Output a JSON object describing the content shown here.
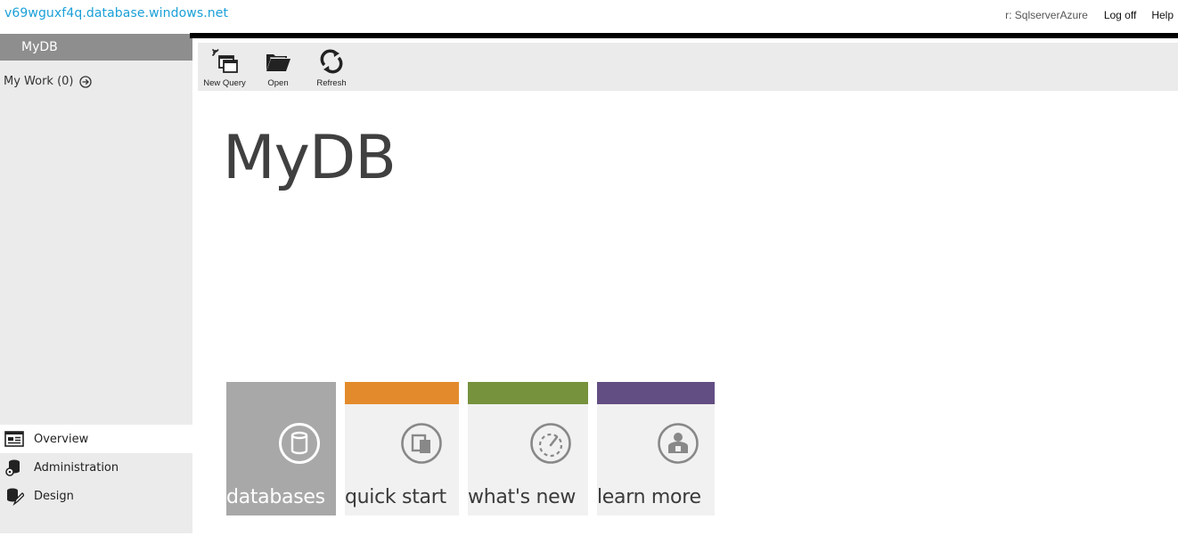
{
  "header": {
    "server_name": "v69wguxf4q.database.windows.net",
    "user": "r: SqlserverAzure",
    "logoff_label": "Log off",
    "help_label": "Help"
  },
  "sidebar": {
    "title": "MyDB",
    "my_work": "My Work (0)",
    "nav": [
      {
        "label": "Overview",
        "icon": "overview-icon",
        "active": true
      },
      {
        "label": "Administration",
        "icon": "administration-icon",
        "active": false
      },
      {
        "label": "Design",
        "icon": "design-icon",
        "active": false
      }
    ]
  },
  "toolbar": {
    "new_query": "New Query",
    "open": "Open",
    "refresh": "Refresh"
  },
  "main": {
    "title": "MyDB"
  },
  "tiles": [
    {
      "label": "databases",
      "icon": "database-icon",
      "bar_color": "#a8a8a8"
    },
    {
      "label": "quick start",
      "icon": "quick-start-icon",
      "bar_color": "#e38b2c"
    },
    {
      "label": "what's new",
      "icon": "gauge-icon",
      "bar_color": "#76923c"
    },
    {
      "label": "learn more",
      "icon": "person-icon",
      "bar_color": "#634e83"
    }
  ],
  "colors": {
    "link": "#1aa0d8",
    "sidebar_bg": "#ebebeb",
    "sidebar_header": "#8e8e8e"
  }
}
